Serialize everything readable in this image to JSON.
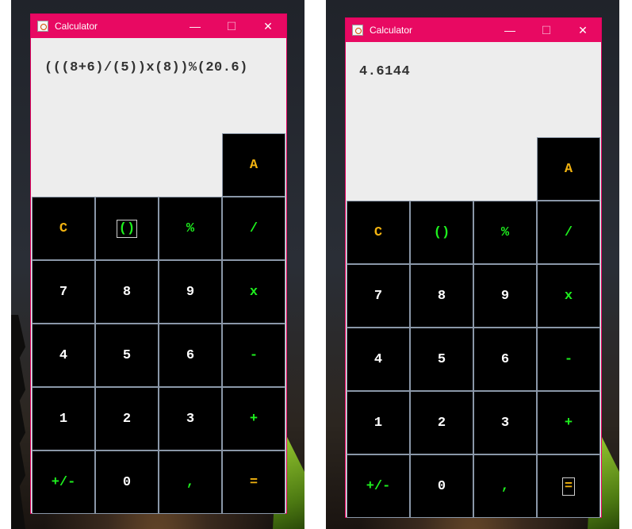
{
  "windows": [
    {
      "title": "Calculator",
      "controls": {
        "minimize": "—",
        "maximize": "☐",
        "close": "✕"
      },
      "display": "(((8+6)/(5))x(8))%(20.6)",
      "keys": {
        "A": "A",
        "C": "C",
        "parens": "()",
        "percent": "%",
        "divide": "/",
        "seven": "7",
        "eight": "8",
        "nine": "9",
        "multiply": "x",
        "four": "4",
        "five": "5",
        "six": "6",
        "minus": "-",
        "one": "1",
        "two": "2",
        "three": "3",
        "plus": "+",
        "negate": "+/-",
        "zero": "0",
        "comma": ",",
        "equals": "="
      }
    },
    {
      "title": "Calculator",
      "controls": {
        "minimize": "—",
        "maximize": "☐",
        "close": "✕"
      },
      "display": "4.6144",
      "keys": {
        "A": "A",
        "C": "C",
        "parens": "()",
        "percent": "%",
        "divide": "/",
        "seven": "7",
        "eight": "8",
        "nine": "9",
        "multiply": "x",
        "four": "4",
        "five": "5",
        "six": "6",
        "minus": "-",
        "one": "1",
        "two": "2",
        "three": "3",
        "plus": "+",
        "negate": "+/-",
        "zero": "0",
        "comma": ",",
        "equals": "="
      }
    }
  ],
  "colors": {
    "titlebar": "#e80962",
    "key_bg": "#000000",
    "key_border": "#8a97a8",
    "accent_orange": "#f2b310",
    "accent_green": "#1ef01e",
    "display_bg": "#ededed"
  },
  "icons": [
    "java-cup-icon",
    "minimize-icon",
    "maximize-icon",
    "close-icon"
  ]
}
